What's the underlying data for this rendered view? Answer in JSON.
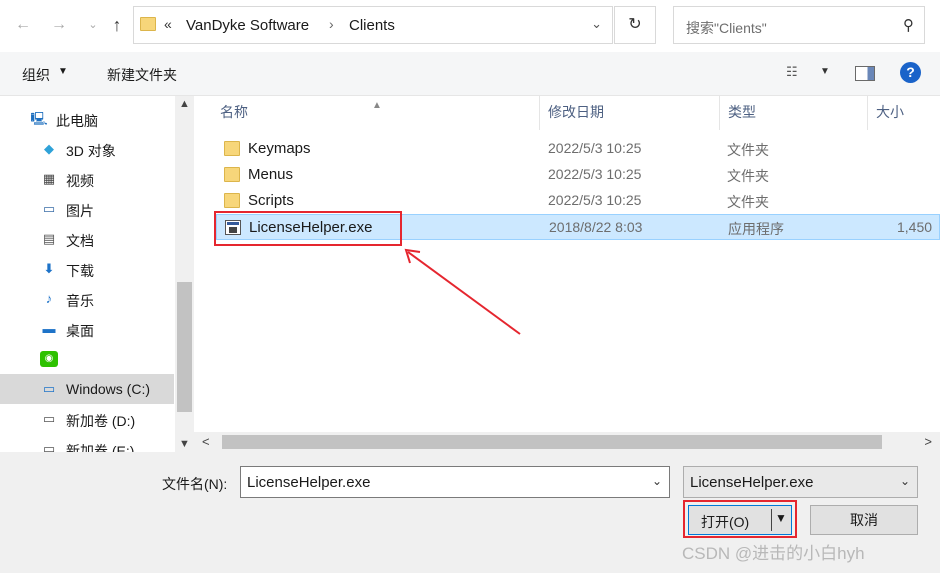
{
  "address": {
    "overflow_chevron": "«",
    "crumbs": [
      "VanDyke Software",
      "Clients"
    ],
    "separator": "›"
  },
  "search": {
    "placeholder": "搜索\"Clients\""
  },
  "toolbar": {
    "organize": "组织",
    "new_folder": "新建文件夹"
  },
  "sidebar": {
    "items": [
      {
        "label": "此电脑",
        "icon": "computer-icon"
      },
      {
        "label": "3D 对象",
        "icon": "cube-icon"
      },
      {
        "label": "视频",
        "icon": "film-icon"
      },
      {
        "label": "图片",
        "icon": "picture-icon"
      },
      {
        "label": "文档",
        "icon": "document-icon"
      },
      {
        "label": "下载",
        "icon": "download-icon"
      },
      {
        "label": "音乐",
        "icon": "music-icon"
      },
      {
        "label": "桌面",
        "icon": "desktop-icon"
      },
      {
        "label": "",
        "icon": "wechat-icon"
      },
      {
        "label": "Windows (C:)",
        "icon": "drive-c-icon"
      },
      {
        "label": "新加卷 (D:)",
        "icon": "drive-icon"
      },
      {
        "label": "新加卷 (E:)",
        "icon": "drive-icon"
      }
    ]
  },
  "columns": {
    "name": "名称",
    "date": "修改日期",
    "type": "类型",
    "size": "大小"
  },
  "files": [
    {
      "name": "Keymaps",
      "date": "2022/5/3 10:25",
      "type": "文件夹",
      "size": ""
    },
    {
      "name": "Menus",
      "date": "2022/5/3 10:25",
      "type": "文件夹",
      "size": ""
    },
    {
      "name": "Scripts",
      "date": "2022/5/3 10:25",
      "type": "文件夹",
      "size": ""
    },
    {
      "name": "LicenseHelper.exe",
      "date": "2018/8/22 8:03",
      "type": "应用程序",
      "size": "1,450"
    }
  ],
  "bottom": {
    "filename_label": "文件名(N):",
    "filename_value": "LicenseHelper.exe",
    "filetype_value": "LicenseHelper.exe",
    "open_label": "打开(O)",
    "cancel_label": "取消"
  },
  "watermark": "CSDN @进击的小白hyh",
  "colors": {
    "highlight": "#e5262f",
    "selection": "#cce8ff",
    "accent": "#0078d7"
  }
}
